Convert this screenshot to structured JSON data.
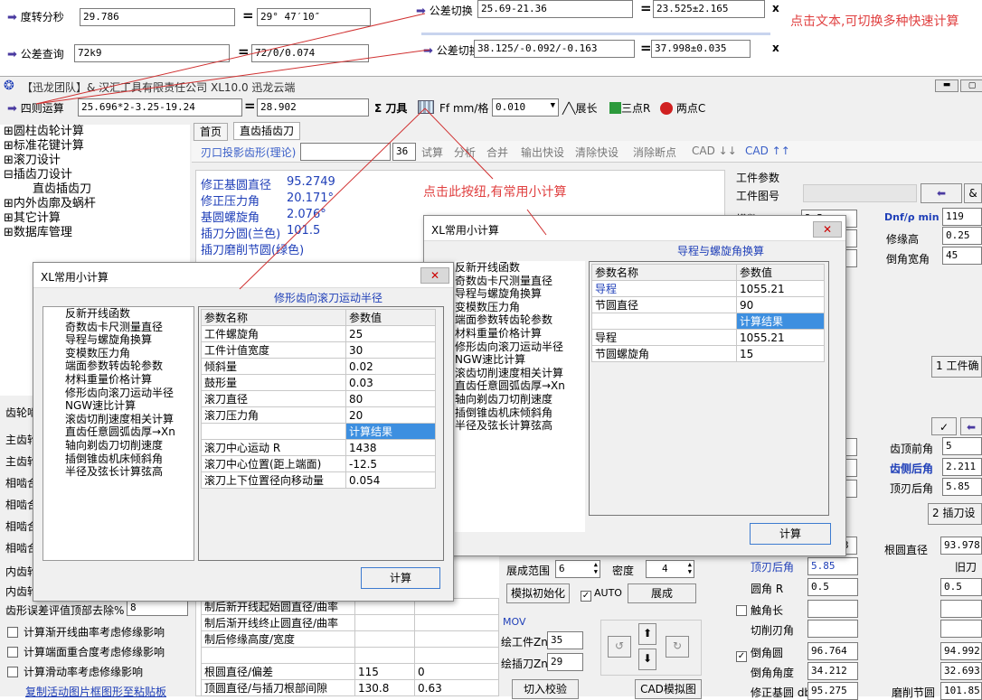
{
  "quick_calc": {
    "deg_to_dms": {
      "label": "度转分秒",
      "input": "29.786",
      "result": "29° 47′10″"
    },
    "tol_query": {
      "label": "公差查询",
      "input": "72k9",
      "result": "72/0/0.074"
    },
    "tol_switch1": {
      "label": "公差切换",
      "input": "25.69-21.36",
      "result": "23.525±2.165"
    },
    "tol_switch2": {
      "label": "公差切换",
      "input": "38.125/-0.092/-0.163",
      "result": "37.998±0.035"
    },
    "arith": {
      "label": "四则运算",
      "input": "25.696*2-3.25-19.24",
      "result": "28.902"
    },
    "eq": "="
  },
  "annotations": {
    "tip_text": "点击文本,可切换多种快速计算",
    "tip_button": "点击此按纽,有常用小计算"
  },
  "window": {
    "title": "【迅龙团队】& 汉汇工具有限责任公司 XL10.0   迅龙云端",
    "toolbar": {
      "sum_label": "Σ 刀具",
      "ff_label": "Ff mm/格",
      "ff_value": "0.010",
      "expand_label": "展长",
      "three_r_label": "三点R",
      "two_c_label": "两点C"
    }
  },
  "sidebar": {
    "items": [
      {
        "label": "圆柱齿轮计算",
        "sign": "⊞"
      },
      {
        "label": "标准花键计算",
        "sign": "⊞"
      },
      {
        "label": "滚刀设计",
        "sign": "⊞"
      },
      {
        "label": "插齿刀设计",
        "sign": "⊟"
      },
      {
        "label": "直齿插齿刀",
        "sign": ""
      },
      {
        "label": "内外齿廓及蜗杆",
        "sign": "⊞"
      },
      {
        "label": "其它计算",
        "sign": "⊞"
      },
      {
        "label": "数据库管理",
        "sign": "⊞"
      }
    ],
    "lower_labels": [
      "齿轮啮",
      "主齿轮",
      "主齿轮",
      "相啮合",
      "相啮合",
      "相啮合",
      "相啮合",
      "内齿轮",
      "内齿轮"
    ],
    "eval_label": "齿形误差评值顶部去除%",
    "eval_value": "8",
    "checks": [
      "计算渐开线曲率考虑修缘影响",
      "计算端面重合度考虑修缘影响",
      "计算滑动率考虑修缘影响"
    ],
    "link": "复制活动图片框图形至粘贴板"
  },
  "tabs": {
    "home": "首页",
    "shaper": "直齿插齿刀"
  },
  "sub_toolbar": {
    "profile_label": "刃口投影齿形(理论)",
    "count": "36",
    "items": [
      "试算",
      "分析",
      "合并",
      "输出快设",
      "清除快设",
      "消除断点",
      "CAD ↓↓",
      "CAD ↑↑"
    ]
  },
  "summary": [
    {
      "label": "修正基圆直径",
      "value": "95.2749"
    },
    {
      "label": "修正压力角",
      "value": "20.171°"
    },
    {
      "label": "基圆螺旋角",
      "value": "2.076°"
    },
    {
      "label": "插刀分圆(兰色)",
      "value": "101.5"
    },
    {
      "label": "插刀磨削节圆(绿色)",
      "value": ""
    }
  ],
  "bottom_table": [
    {
      "name": "制后新开线起始圆直径/曲率",
      "v1": "",
      "v2": ""
    },
    {
      "name": "制后渐开线终止圆直径/曲率",
      "v1": "",
      "v2": ""
    },
    {
      "name": "制后修缘高度/宽度",
      "v1": "",
      "v2": ""
    },
    {
      "name": "",
      "v1": "",
      "v2": ""
    },
    {
      "name": "根圆直径/偏差",
      "v1": "115",
      "v2": "0"
    },
    {
      "name": "顶圆直径/与插刀根部间隙",
      "v1": "130.8",
      "v2": "0.63"
    }
  ],
  "middle_panel": {
    "range_label": "展成范围",
    "range_value": "6",
    "density_label": "密度",
    "density_value": "4",
    "sim_init": "模拟初始化",
    "auto_label": "AUTO",
    "gen_btn": "展成",
    "mov_label": "MOV",
    "zn_work_label": "绘工件Zn",
    "zn_work_value": "35",
    "zn_tool_label": "绘插刀Zn",
    "zn_tool_value": "29",
    "check_btn": "切入校验",
    "cad_btn": "CAD模拟图"
  },
  "right_panel": {
    "params_label": "工件参数",
    "drawing_label": "工件图号",
    "module_label": "模数",
    "module_value": "3.5",
    "dnf_label": "Dnf/ρ min",
    "dnf_value": "119",
    "edge_label": "修缘高",
    "edge_value": "0.25",
    "chamfer_label": "倒角宽角",
    "chamfer_value": "45",
    "tab1": "1 工件确",
    "tab2": "2 插刀设",
    "front_label": "齿顶前角",
    "front_value": "5",
    "side_label": "齿侧后角",
    "side_value": "2.211",
    "top_label": "顶刃后角",
    "top_value": "5.85",
    "root_label": "根圆直径",
    "root_value": "93.978",
    "old_label": "旧刀",
    "top_edge_label": "顶刃后角",
    "top_edge_value": "5.85",
    "round_label": "圆角 R",
    "round_value": "0.5",
    "round_value2": "0.5",
    "touch_label": "触角长",
    "cut_label": "切削刃角",
    "cham_round_label": "倒角圆",
    "cham_round_value": "96.764",
    "cham_round_value2": "94.992",
    "cham_angle_label": "倒角角度",
    "cham_angle_value": "34.212",
    "cham_angle_value2": "32.693",
    "fix_label": "修正基圆 db",
    "fix_value": "95.275",
    "grind_label": "磨削节圆",
    "grind_value": "101.85",
    "small_value": "3"
  },
  "dialog_left": {
    "title": "XL常用小计算",
    "heading": "修形齿向滚刀运动半径",
    "list": [
      "反新开线函数",
      "奇数齿卡尺测量直径",
      "导程与螺旋角换算",
      "变模数压力角",
      "端面参数转齿轮参数",
      "材料重量价格计算",
      "修形齿向滚刀运动半径",
      "NGW速比计算",
      "滚齿切削速度相关计算",
      "直齿任意圆弧齿厚→Xn",
      "轴向剃齿刀切削速度",
      "插倒锥齿机床倾斜角",
      "半径及弦长计算弦高"
    ],
    "col_name": "参数名称",
    "col_value": "参数值",
    "rows": [
      {
        "name": "工件螺旋角",
        "value": "25"
      },
      {
        "name": "工件计值宽度",
        "value": "30"
      },
      {
        "name": "倾斜量",
        "value": "0.02"
      },
      {
        "name": "鼓形量",
        "value": "0.03"
      },
      {
        "name": "滚刀直径",
        "value": "80"
      },
      {
        "name": "滚刀压力角",
        "value": "20"
      },
      {
        "name": "",
        "value": "计算结果",
        "hl": true
      },
      {
        "name": "滚刀中心运动 R",
        "value": "1438"
      },
      {
        "name": "滚刀中心位置(距上端面)",
        "value": "-12.5"
      },
      {
        "name": "滚刀上下位置径向移动量",
        "value": "0.054"
      }
    ],
    "button": "计算"
  },
  "dialog_right": {
    "title": "XL常用小计算",
    "heading": "导程与螺旋角换算",
    "list": [
      "反新开线函数",
      "奇数齿卡尺测量直径",
      "导程与螺旋角换算",
      "变模数压力角",
      "端面参数转齿轮参数",
      "材料重量价格计算",
      "修形齿向滚刀运动半径",
      "NGW速比计算",
      "滚齿切削速度相关计算",
      "直齿任意圆弧齿厚→Xn",
      "轴向剃齿刀切削速度",
      "插倒锥齿机床倾斜角",
      "半径及弦长计算弦高"
    ],
    "col_name": "参数名称",
    "col_value": "参数值",
    "rows": [
      {
        "name": "导程",
        "value": "1055.21",
        "blue": true
      },
      {
        "name": "节圆直径",
        "value": "90"
      },
      {
        "name": "",
        "value": "计算结果",
        "hl": true
      },
      {
        "name": "导程",
        "value": "1055.21"
      },
      {
        "name": "节圆螺旋角",
        "value": "15"
      }
    ],
    "button": "计算"
  }
}
